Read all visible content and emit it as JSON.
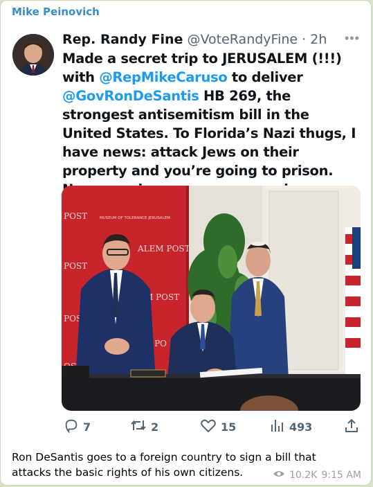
{
  "channel": {
    "name": "Mike Peinovich"
  },
  "tweet": {
    "author_name": "Rep. Randy Fine",
    "author_handle": "@VoteRandyFine",
    "time": "2h",
    "text_1": "Made a secret trip to JERUSALEM (!!!) with",
    "mention_1": "@RepMikeCaruso",
    "text_2": " to deliver",
    "mention_2": "@GovRonDeSantis",
    "text_3": " HB 269, the strongest antisemitism bill in the United States.  To Florida’s Nazi thugs, I have news: attack Jews on their property and you’re going to prison.  Never again means never again.",
    "photo_banner_words": [
      "POST",
      "MUSEUM OF TOLERANCE JERUSALEM",
      "ALEM POST"
    ],
    "replies": "7",
    "retweets": "2",
    "likes": "15",
    "views": "493"
  },
  "caption": "Ron DeSantis goes to a foreign country to sign a bill that attacks the basic rights of his own citizens.",
  "message_meta": {
    "views": "10.2K",
    "time": "9:15 AM"
  },
  "icons": [
    "reply-icon",
    "retweet-icon",
    "like-icon",
    "views-icon",
    "share-icon",
    "eye-icon",
    "more-icon"
  ],
  "colors": {
    "channel": "#3a8cc8",
    "mention": "#1d9bf0",
    "text": "#0f1419",
    "muted": "#536471",
    "background": "#d9e4c4"
  }
}
